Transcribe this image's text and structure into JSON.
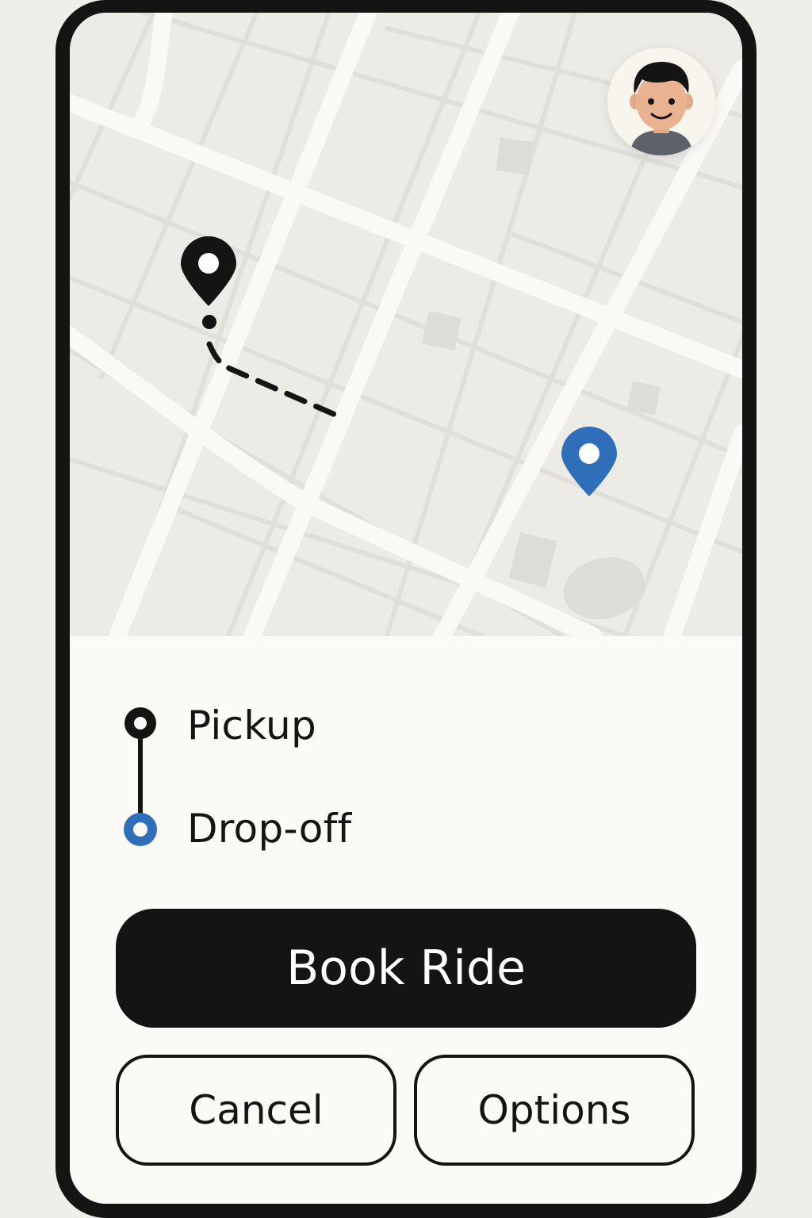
{
  "map": {
    "user_avatar": "user-avatar",
    "pickup_pin": "location-pin-icon",
    "dropoff_pin": "location-pin-icon",
    "route_style": "dashed"
  },
  "trip": {
    "pickup_label": "Pickup",
    "dropoff_label": "Drop-off"
  },
  "actions": {
    "book_label": "Book Ride",
    "cancel_label": "Cancel",
    "options_label": "Options"
  },
  "colors": {
    "primary": "#141414",
    "accent": "#2f6fba",
    "background": "#fbfaf6",
    "map_background": "#ecebe6",
    "road": "#faf9f5"
  }
}
